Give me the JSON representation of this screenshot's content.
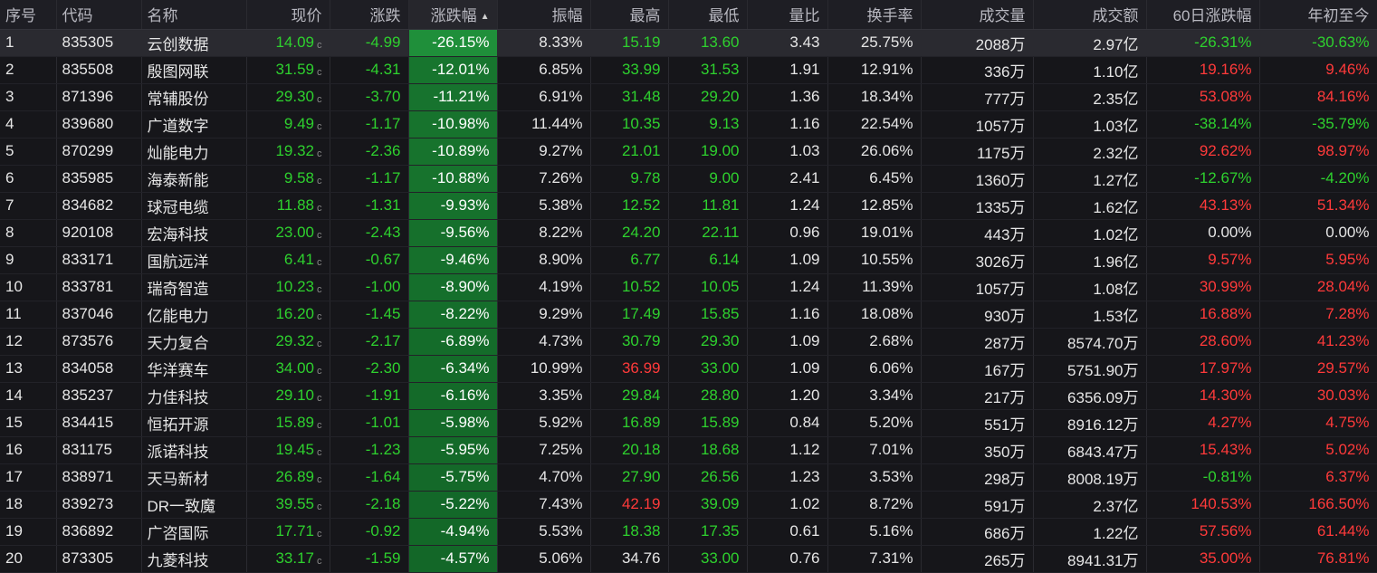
{
  "headers": {
    "idx": "序号",
    "code": "代码",
    "name": "名称",
    "price": "现价",
    "chg": "涨跌",
    "pct": "涨跌幅",
    "amp": "振幅",
    "high": "最高",
    "low": "最低",
    "ratio": "量比",
    "turn": "换手率",
    "vol": "成交量",
    "amt": "成交额",
    "d60": "60日涨跌幅",
    "ytd": "年初至今"
  },
  "sort_icon": "sort-desc-arrow-icon",
  "price_tag": "c",
  "colors": {
    "up": "#ff3a3a",
    "down": "#2ed12e",
    "flat": "#e6e6e6",
    "pct_bg_max": "#1f8f3a",
    "pct_bg_min": "#0f5a22"
  },
  "rows": [
    {
      "idx": "1",
      "code": "835305",
      "name": "云创数据",
      "price": "14.09",
      "chg": "-4.99",
      "pct": "-26.15%",
      "pct_val": -26.15,
      "amp": "8.33%",
      "high": "15.19",
      "high_dir": "down",
      "low": "13.60",
      "low_dir": "down",
      "ratio": "3.43",
      "turn": "25.75%",
      "vol": "2088万",
      "amt": "2.97亿",
      "d60": "-26.31%",
      "d60_dir": "down",
      "ytd": "-30.63%",
      "ytd_dir": "down"
    },
    {
      "idx": "2",
      "code": "835508",
      "name": "殷图网联",
      "price": "31.59",
      "chg": "-4.31",
      "pct": "-12.01%",
      "pct_val": -12.01,
      "amp": "6.85%",
      "high": "33.99",
      "high_dir": "down",
      "low": "31.53",
      "low_dir": "down",
      "ratio": "1.91",
      "turn": "12.91%",
      "vol": "336万",
      "amt": "1.10亿",
      "d60": "19.16%",
      "d60_dir": "up",
      "ytd": "9.46%",
      "ytd_dir": "up"
    },
    {
      "idx": "3",
      "code": "871396",
      "name": "常辅股份",
      "price": "29.30",
      "chg": "-3.70",
      "pct": "-11.21%",
      "pct_val": -11.21,
      "amp": "6.91%",
      "high": "31.48",
      "high_dir": "down",
      "low": "29.20",
      "low_dir": "down",
      "ratio": "1.36",
      "turn": "18.34%",
      "vol": "777万",
      "amt": "2.35亿",
      "d60": "53.08%",
      "d60_dir": "up",
      "ytd": "84.16%",
      "ytd_dir": "up"
    },
    {
      "idx": "4",
      "code": "839680",
      "name": "广道数字",
      "price": "9.49",
      "chg": "-1.17",
      "pct": "-10.98%",
      "pct_val": -10.98,
      "amp": "11.44%",
      "high": "10.35",
      "high_dir": "down",
      "low": "9.13",
      "low_dir": "down",
      "ratio": "1.16",
      "turn": "22.54%",
      "vol": "1057万",
      "amt": "1.03亿",
      "d60": "-38.14%",
      "d60_dir": "down",
      "ytd": "-35.79%",
      "ytd_dir": "down"
    },
    {
      "idx": "5",
      "code": "870299",
      "name": "灿能电力",
      "price": "19.32",
      "chg": "-2.36",
      "pct": "-10.89%",
      "pct_val": -10.89,
      "amp": "9.27%",
      "high": "21.01",
      "high_dir": "down",
      "low": "19.00",
      "low_dir": "down",
      "ratio": "1.03",
      "turn": "26.06%",
      "vol": "1175万",
      "amt": "2.32亿",
      "d60": "92.62%",
      "d60_dir": "up",
      "ytd": "98.97%",
      "ytd_dir": "up"
    },
    {
      "idx": "6",
      "code": "835985",
      "name": "海泰新能",
      "price": "9.58",
      "chg": "-1.17",
      "pct": "-10.88%",
      "pct_val": -10.88,
      "amp": "7.26%",
      "high": "9.78",
      "high_dir": "down",
      "low": "9.00",
      "low_dir": "down",
      "ratio": "2.41",
      "turn": "6.45%",
      "vol": "1360万",
      "amt": "1.27亿",
      "d60": "-12.67%",
      "d60_dir": "down",
      "ytd": "-4.20%",
      "ytd_dir": "down"
    },
    {
      "idx": "7",
      "code": "834682",
      "name": "球冠电缆",
      "price": "11.88",
      "chg": "-1.31",
      "pct": "-9.93%",
      "pct_val": -9.93,
      "amp": "5.38%",
      "high": "12.52",
      "high_dir": "down",
      "low": "11.81",
      "low_dir": "down",
      "ratio": "1.24",
      "turn": "12.85%",
      "vol": "1335万",
      "amt": "1.62亿",
      "d60": "43.13%",
      "d60_dir": "up",
      "ytd": "51.34%",
      "ytd_dir": "up"
    },
    {
      "idx": "8",
      "code": "920108",
      "name": "宏海科技",
      "price": "23.00",
      "chg": "-2.43",
      "pct": "-9.56%",
      "pct_val": -9.56,
      "amp": "8.22%",
      "high": "24.20",
      "high_dir": "down",
      "low": "22.11",
      "low_dir": "down",
      "ratio": "0.96",
      "turn": "19.01%",
      "vol": "443万",
      "amt": "1.02亿",
      "d60": "0.00%",
      "d60_dir": "flat",
      "ytd": "0.00%",
      "ytd_dir": "flat"
    },
    {
      "idx": "9",
      "code": "833171",
      "name": "国航远洋",
      "price": "6.41",
      "chg": "-0.67",
      "pct": "-9.46%",
      "pct_val": -9.46,
      "amp": "8.90%",
      "high": "6.77",
      "high_dir": "down",
      "low": "6.14",
      "low_dir": "down",
      "ratio": "1.09",
      "turn": "10.55%",
      "vol": "3026万",
      "amt": "1.96亿",
      "d60": "9.57%",
      "d60_dir": "up",
      "ytd": "5.95%",
      "ytd_dir": "up"
    },
    {
      "idx": "10",
      "code": "833781",
      "name": "瑞奇智造",
      "price": "10.23",
      "chg": "-1.00",
      "pct": "-8.90%",
      "pct_val": -8.9,
      "amp": "4.19%",
      "high": "10.52",
      "high_dir": "down",
      "low": "10.05",
      "low_dir": "down",
      "ratio": "1.24",
      "turn": "11.39%",
      "vol": "1057万",
      "amt": "1.08亿",
      "d60": "30.99%",
      "d60_dir": "up",
      "ytd": "28.04%",
      "ytd_dir": "up"
    },
    {
      "idx": "11",
      "code": "837046",
      "name": "亿能电力",
      "price": "16.20",
      "chg": "-1.45",
      "pct": "-8.22%",
      "pct_val": -8.22,
      "amp": "9.29%",
      "high": "17.49",
      "high_dir": "down",
      "low": "15.85",
      "low_dir": "down",
      "ratio": "1.16",
      "turn": "18.08%",
      "vol": "930万",
      "amt": "1.53亿",
      "d60": "16.88%",
      "d60_dir": "up",
      "ytd": "7.28%",
      "ytd_dir": "up"
    },
    {
      "idx": "12",
      "code": "873576",
      "name": "天力复合",
      "price": "29.32",
      "chg": "-2.17",
      "pct": "-6.89%",
      "pct_val": -6.89,
      "amp": "4.73%",
      "high": "30.79",
      "high_dir": "down",
      "low": "29.30",
      "low_dir": "down",
      "ratio": "1.09",
      "turn": "2.68%",
      "vol": "287万",
      "amt": "8574.70万",
      "d60": "28.60%",
      "d60_dir": "up",
      "ytd": "41.23%",
      "ytd_dir": "up"
    },
    {
      "idx": "13",
      "code": "834058",
      "name": "华洋赛车",
      "price": "34.00",
      "chg": "-2.30",
      "pct": "-6.34%",
      "pct_val": -6.34,
      "amp": "10.99%",
      "high": "36.99",
      "high_dir": "up",
      "low": "33.00",
      "low_dir": "down",
      "ratio": "1.09",
      "turn": "6.06%",
      "vol": "167万",
      "amt": "5751.90万",
      "d60": "17.97%",
      "d60_dir": "up",
      "ytd": "29.57%",
      "ytd_dir": "up"
    },
    {
      "idx": "14",
      "code": "835237",
      "name": "力佳科技",
      "price": "29.10",
      "chg": "-1.91",
      "pct": "-6.16%",
      "pct_val": -6.16,
      "amp": "3.35%",
      "high": "29.84",
      "high_dir": "down",
      "low": "28.80",
      "low_dir": "down",
      "ratio": "1.20",
      "turn": "3.34%",
      "vol": "217万",
      "amt": "6356.09万",
      "d60": "14.30%",
      "d60_dir": "up",
      "ytd": "30.03%",
      "ytd_dir": "up"
    },
    {
      "idx": "15",
      "code": "834415",
      "name": "恒拓开源",
      "price": "15.89",
      "chg": "-1.01",
      "pct": "-5.98%",
      "pct_val": -5.98,
      "amp": "5.92%",
      "high": "16.89",
      "high_dir": "down",
      "low": "15.89",
      "low_dir": "down",
      "ratio": "0.84",
      "turn": "5.20%",
      "vol": "551万",
      "amt": "8916.12万",
      "d60": "4.27%",
      "d60_dir": "up",
      "ytd": "4.75%",
      "ytd_dir": "up"
    },
    {
      "idx": "16",
      "code": "831175",
      "name": "派诺科技",
      "price": "19.45",
      "chg": "-1.23",
      "pct": "-5.95%",
      "pct_val": -5.95,
      "amp": "7.25%",
      "high": "20.18",
      "high_dir": "down",
      "low": "18.68",
      "low_dir": "down",
      "ratio": "1.12",
      "turn": "7.01%",
      "vol": "350万",
      "amt": "6843.47万",
      "d60": "15.43%",
      "d60_dir": "up",
      "ytd": "5.02%",
      "ytd_dir": "up"
    },
    {
      "idx": "17",
      "code": "838971",
      "name": "天马新材",
      "price": "26.89",
      "chg": "-1.64",
      "pct": "-5.75%",
      "pct_val": -5.75,
      "amp": "4.70%",
      "high": "27.90",
      "high_dir": "down",
      "low": "26.56",
      "low_dir": "down",
      "ratio": "1.23",
      "turn": "3.53%",
      "vol": "298万",
      "amt": "8008.19万",
      "d60": "-0.81%",
      "d60_dir": "down",
      "ytd": "6.37%",
      "ytd_dir": "up"
    },
    {
      "idx": "18",
      "code": "839273",
      "name": "DR一致魔",
      "price": "39.55",
      "chg": "-2.18",
      "pct": "-5.22%",
      "pct_val": -5.22,
      "amp": "7.43%",
      "high": "42.19",
      "high_dir": "up",
      "low": "39.09",
      "low_dir": "down",
      "ratio": "1.02",
      "turn": "8.72%",
      "vol": "591万",
      "amt": "2.37亿",
      "d60": "140.53%",
      "d60_dir": "up",
      "ytd": "166.50%",
      "ytd_dir": "up"
    },
    {
      "idx": "19",
      "code": "836892",
      "name": "广咨国际",
      "price": "17.71",
      "chg": "-0.92",
      "pct": "-4.94%",
      "pct_val": -4.94,
      "amp": "5.53%",
      "high": "18.38",
      "high_dir": "down",
      "low": "17.35",
      "low_dir": "down",
      "ratio": "0.61",
      "turn": "5.16%",
      "vol": "686万",
      "amt": "1.22亿",
      "d60": "57.56%",
      "d60_dir": "up",
      "ytd": "61.44%",
      "ytd_dir": "up"
    },
    {
      "idx": "20",
      "code": "873305",
      "name": "九菱科技",
      "price": "33.17",
      "chg": "-1.59",
      "pct": "-4.57%",
      "pct_val": -4.57,
      "amp": "5.06%",
      "high": "34.76",
      "high_dir": "flat",
      "low": "33.00",
      "low_dir": "down",
      "ratio": "0.76",
      "turn": "7.31%",
      "vol": "265万",
      "amt": "8941.31万",
      "d60": "35.00%",
      "d60_dir": "up",
      "ytd": "76.81%",
      "ytd_dir": "up"
    }
  ]
}
